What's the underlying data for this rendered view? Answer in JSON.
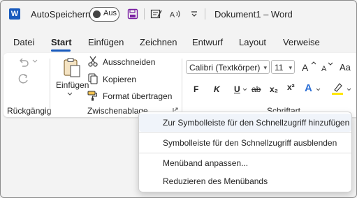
{
  "titlebar": {
    "app_icon_letter": "W",
    "autosave_label": "AutoSpeichern",
    "autosave_toggle": "Aus",
    "document_title": "Dokument1 – Word",
    "qat_icons": [
      "save-icon",
      "touch-mode-icon",
      "read-aloud-icon",
      "customize-qat-icon"
    ]
  },
  "tabs": [
    "Datei",
    "Start",
    "Einfügen",
    "Zeichnen",
    "Entwurf",
    "Layout",
    "Verweise"
  ],
  "active_tab": "Start",
  "ribbon": {
    "undo_group": {
      "label": "Rückgängig"
    },
    "clipboard": {
      "paste_label": "Einfügen",
      "cut_label": "Ausschneiden",
      "copy_label": "Kopieren",
      "format_painter_label": "Format übertragen",
      "group_label": "Zwischenablage"
    },
    "font": {
      "font_name": "Calibri (Textkörper)",
      "font_size": "11",
      "case_label": "Aa",
      "bold": "F",
      "italic": "K",
      "strike": "ab",
      "subscript": "x₂",
      "superscript": "x²",
      "effects": "A",
      "group_label": "Schriftart"
    }
  },
  "context_menu": {
    "items": [
      "Zur Symbolleiste für den Schnellzugriff hinzufügen",
      "Symbolleiste für den Schnellzugriff ausblenden",
      "Menüband anpassen...",
      "Reduzieren des Menübands"
    ],
    "highlighted_index": 0
  },
  "colors": {
    "accent": "#185abd",
    "highlight": "#ffe600",
    "effects_blue": "#2b6fd6",
    "menu_hover": "#f0f4fa"
  }
}
